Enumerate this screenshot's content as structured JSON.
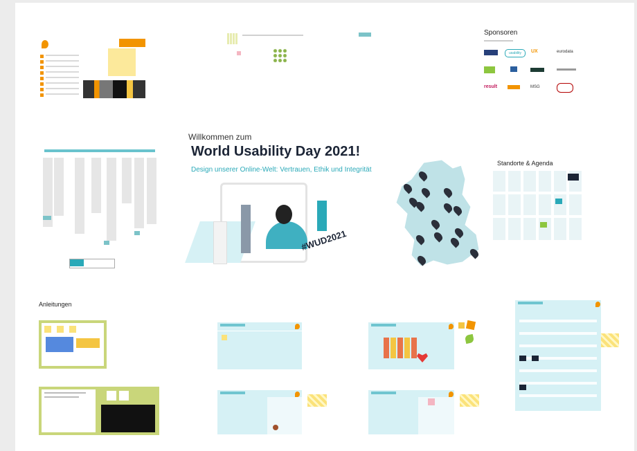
{
  "welcome": {
    "pre_title": "Willkommen zum",
    "title": "World Usability Day 2021!",
    "subtitle": "Design unserer Online-Welt: Vertrauen, Ethik und Integrität",
    "hashtag": "#WUD2021"
  },
  "sponsors": {
    "heading": "Sponsoren",
    "logos": [
      "usability",
      "UX",
      "eurodata",
      "result",
      "MSG"
    ]
  },
  "locations": {
    "heading": "Standorte & Agenda"
  },
  "instructions": {
    "heading": "Anleitungen"
  },
  "colors": {
    "accent": "#f29400",
    "teal": "#2aa9b8",
    "cyan_bg": "#d6f1f5",
    "map": "#bfe2e7",
    "olive": "#c9d67a"
  }
}
